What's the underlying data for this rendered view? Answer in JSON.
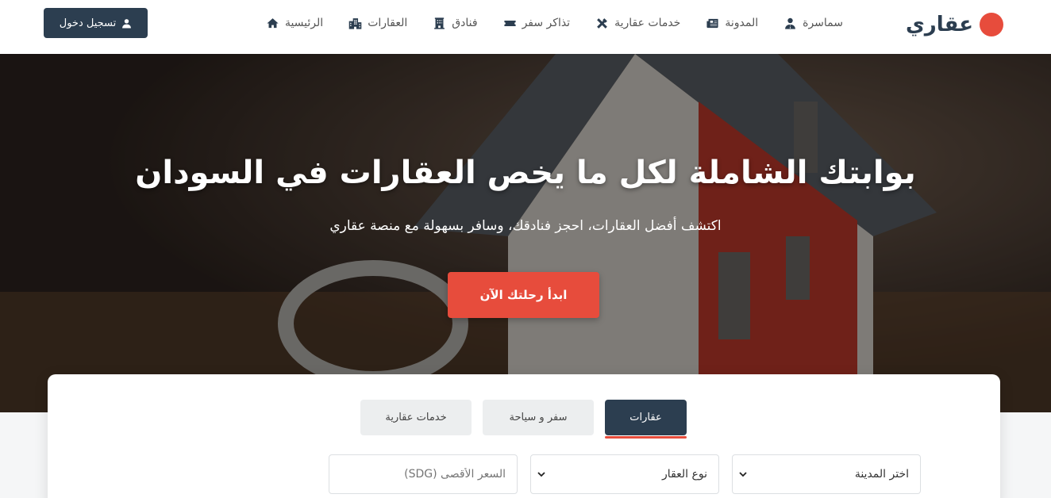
{
  "header": {
    "logo_text": "عقاري",
    "login_label": "تسجيل دخول",
    "nav": [
      {
        "label": "الرئيسية",
        "icon": "home-icon"
      },
      {
        "label": "العقارات",
        "icon": "buildings-icon"
      },
      {
        "label": "فنادق",
        "icon": "hotel-icon"
      },
      {
        "label": "تذاكر سفر",
        "icon": "ticket-icon"
      },
      {
        "label": "خدمات عقارية",
        "icon": "tools-icon"
      },
      {
        "label": "المدونة",
        "icon": "newspaper-icon"
      },
      {
        "label": "سماسرة",
        "icon": "broker-icon"
      }
    ]
  },
  "hero": {
    "title": "بوابتك الشاملة لكل ما يخص العقارات في السودان",
    "subtitle": "اكتشف أفضل العقارات، احجز فنادقك، وسافر بسهولة مع منصة عقاري",
    "cta_label": "ابدأ رحلتك الآن"
  },
  "search": {
    "tabs": {
      "properties": "عقارات",
      "travel": "سفر و سياحة",
      "services": "خدمات عقارية"
    },
    "city_select": "اختر المدينة",
    "type_select": "نوع العقار",
    "max_price_placeholder": "السعر الأقصى (SDG)"
  },
  "colors": {
    "primary": "#2c3e50",
    "accent": "#e74c3c"
  }
}
